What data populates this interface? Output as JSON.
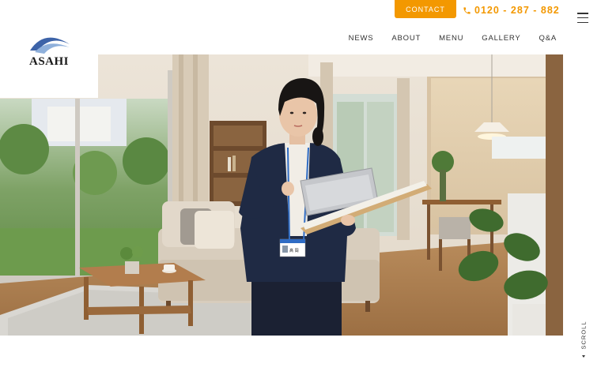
{
  "brand": {
    "logo_text": "ASAHI",
    "accent_color": "#f39800",
    "logo_color": "#3d63a8"
  },
  "header": {
    "contact_label": "CONTACT",
    "phone_number": "0120 - 287 - 882",
    "nav": [
      "NEWS",
      "ABOUT",
      "MENU",
      "GALLERY",
      "Q&A"
    ]
  },
  "hero": {
    "badge_name": "髙 岡"
  },
  "scroll": {
    "label": "SCROLL"
  }
}
